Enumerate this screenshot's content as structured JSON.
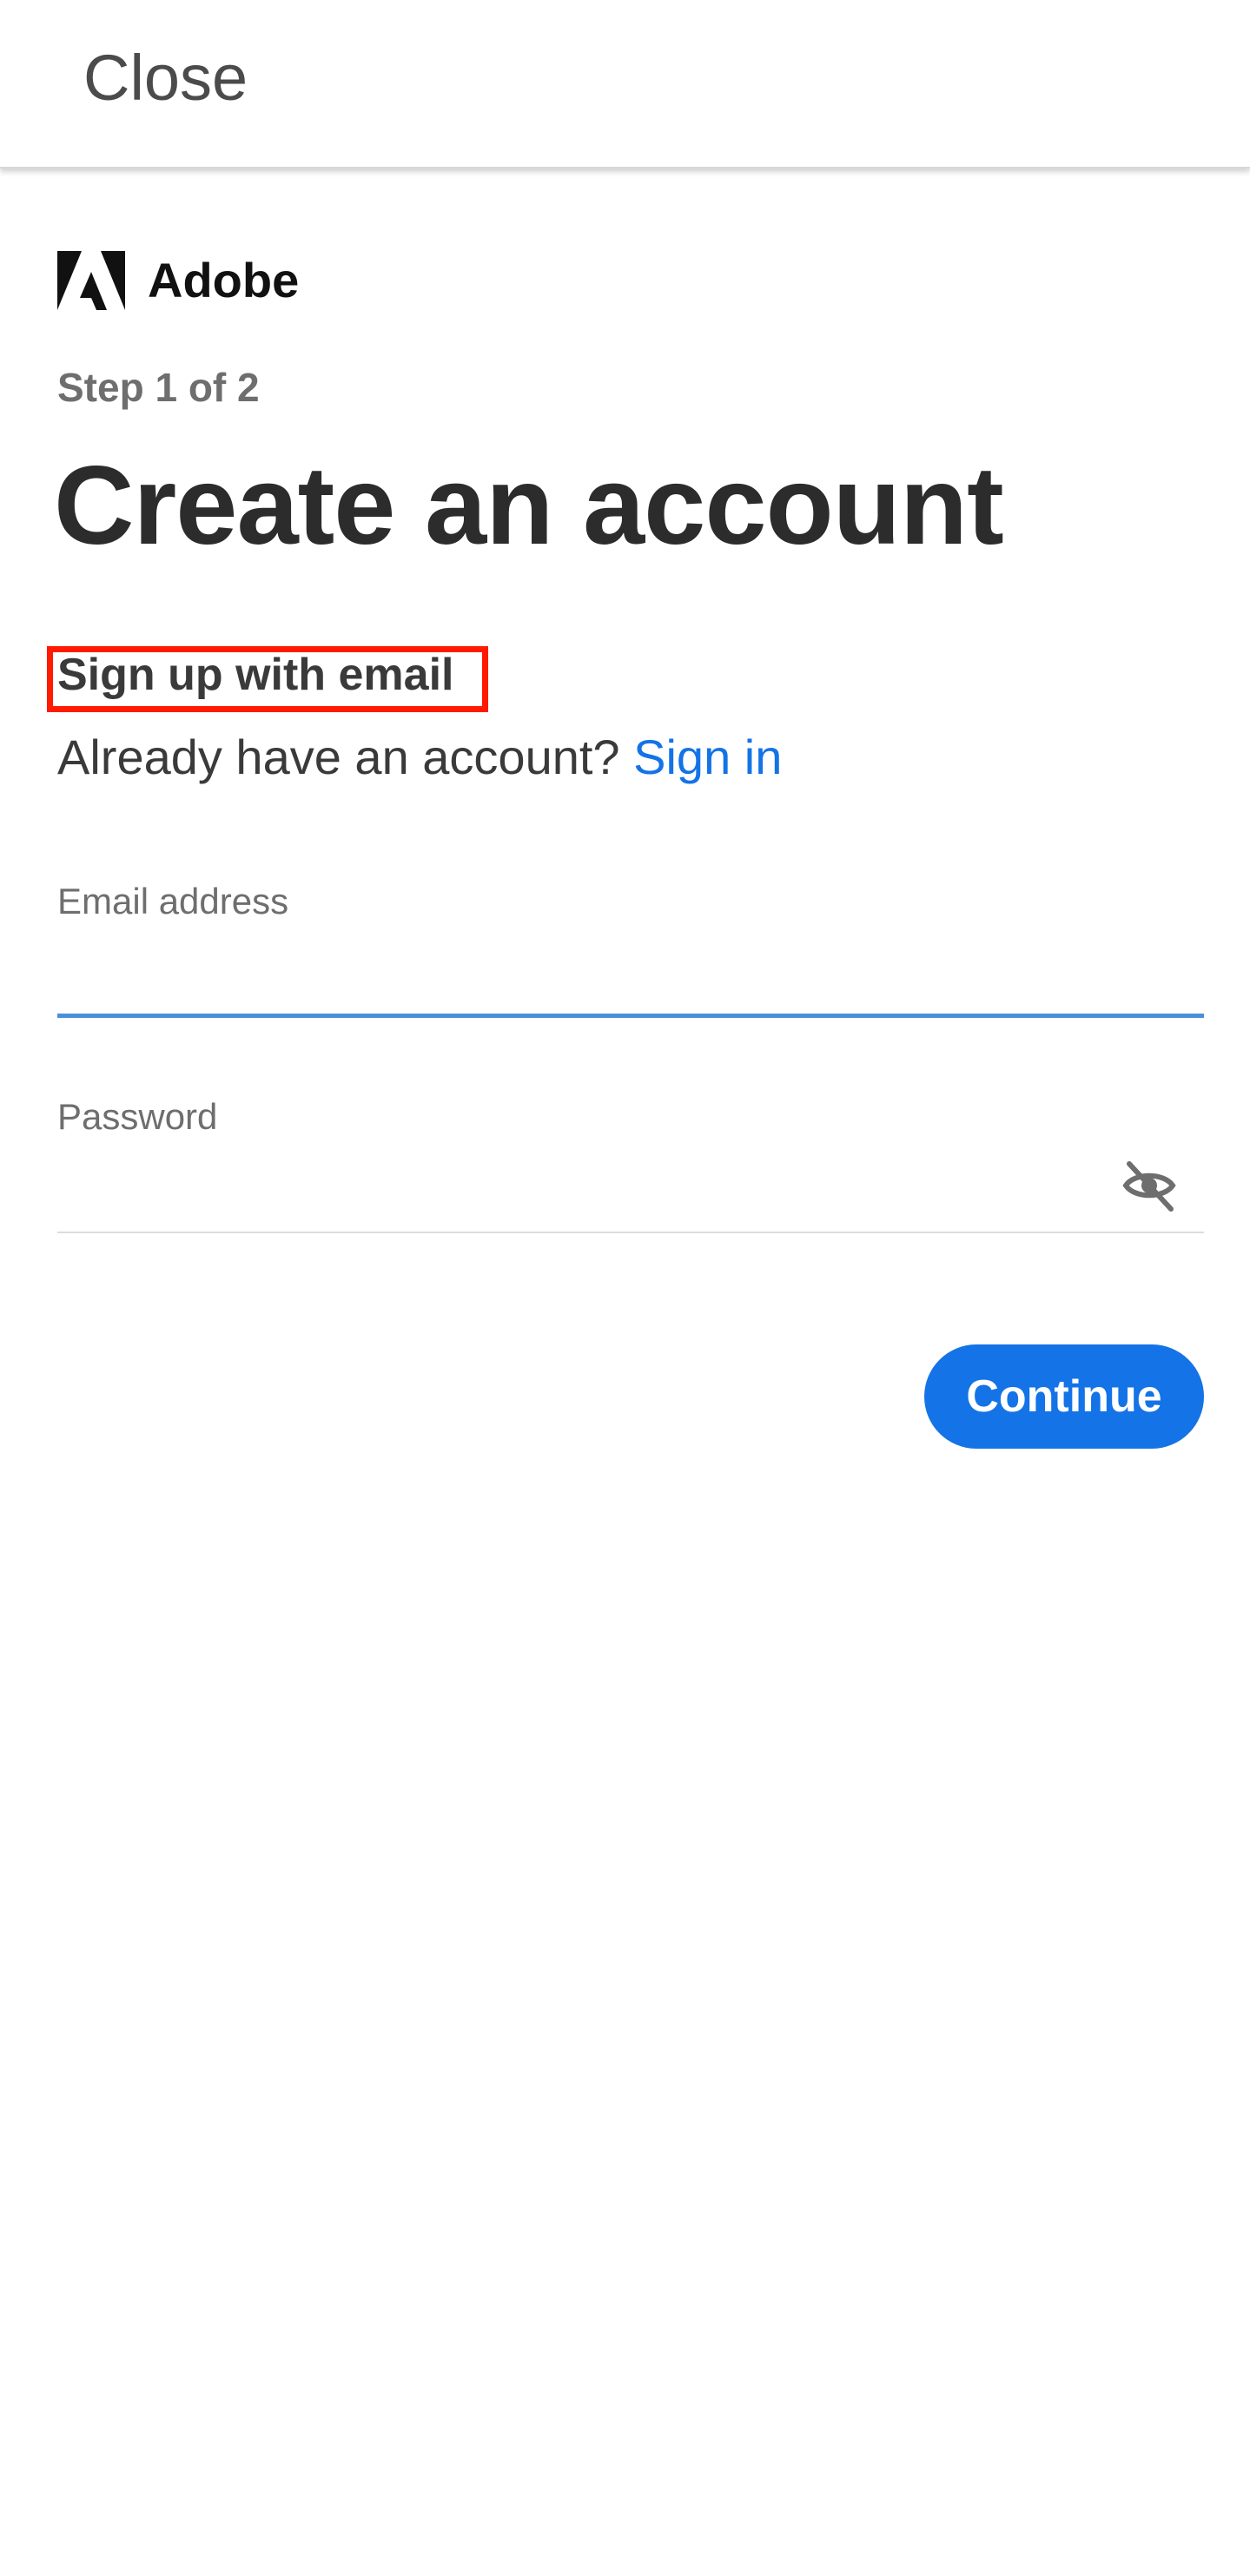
{
  "header": {
    "close_label": "Close"
  },
  "brand": {
    "name": "Adobe",
    "logo_icon": "adobe-logo-icon"
  },
  "form": {
    "step": "Step 1 of 2",
    "title": "Create an account",
    "subheading": "Sign up with email",
    "already_text": "Already have an account? ",
    "signin_label": "Sign in",
    "email": {
      "label": "Email address",
      "value": ""
    },
    "password": {
      "label": "Password",
      "value": "",
      "toggle_icon": "eye-slash-icon"
    },
    "continue_label": "Continue"
  },
  "colors": {
    "accent": "#1473e6",
    "highlight_box": "#ff1a00",
    "focus_underline": "#4a90d9"
  }
}
